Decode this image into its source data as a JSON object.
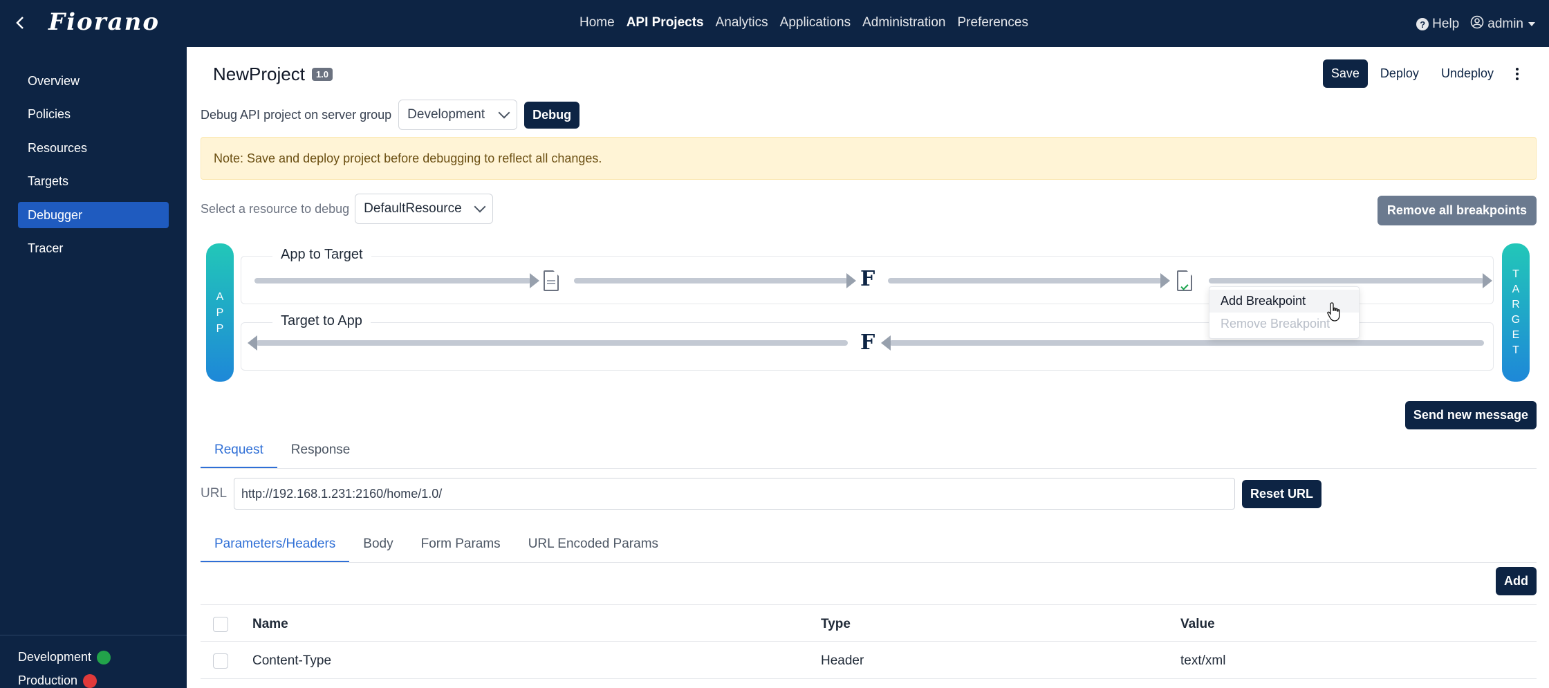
{
  "topbar": {
    "logo": "Fiorano",
    "nav": [
      "Home",
      "API Projects",
      "Analytics",
      "Applications",
      "Administration",
      "Preferences"
    ],
    "active_nav": "API Projects",
    "help": "Help",
    "user": "admin"
  },
  "sidebar": {
    "items": [
      "Overview",
      "Policies",
      "Resources",
      "Targets",
      "Debugger",
      "Tracer"
    ],
    "active": "Debugger",
    "environments": [
      {
        "name": "Development",
        "status_color": "#22a34a"
      },
      {
        "name": "Production",
        "status_color": "#e03a3a"
      }
    ]
  },
  "project": {
    "name": "NewProject",
    "version": "1.0",
    "save": "Save",
    "deploy": "Deploy",
    "undeploy": "Undeploy"
  },
  "debug": {
    "label": "Debug API project on server group",
    "server_group": "Development",
    "button": "Debug",
    "note": "Note: Save and deploy project before debugging to reflect all changes.",
    "resource_label": "Select a resource to debug",
    "resource": "DefaultResource",
    "remove_all": "Remove all breakpoints"
  },
  "flow": {
    "app_label": [
      "A",
      "P",
      "P"
    ],
    "target_label": [
      "T",
      "A",
      "R",
      "G",
      "E",
      "T"
    ],
    "lane_top": "App to Target",
    "lane_bottom": "Target to App",
    "f_glyph": "F",
    "context_menu": {
      "add": "Add Breakpoint",
      "remove": "Remove Breakpoint"
    }
  },
  "send_new_message": "Send new message",
  "req_tabs": [
    "Request",
    "Response"
  ],
  "url": {
    "label": "URL",
    "value": "http://192.168.1.231:2160/home/1.0/",
    "reset": "Reset URL"
  },
  "param_tabs": [
    "Parameters/Headers",
    "Body",
    "Form Params",
    "URL Encoded Params"
  ],
  "add": "Add",
  "table": {
    "columns": [
      "Name",
      "Type",
      "Value"
    ],
    "rows": [
      [
        "Content-Type",
        "Header",
        "text/xml"
      ]
    ]
  }
}
